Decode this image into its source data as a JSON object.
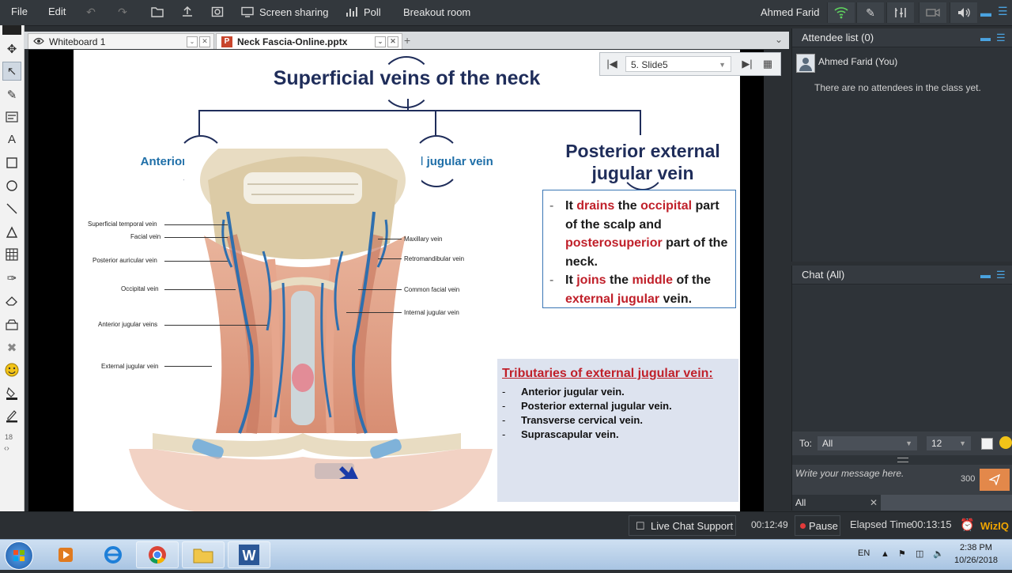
{
  "menu": {
    "file": "File",
    "edit": "Edit",
    "screen_sharing": "Screen sharing",
    "poll": "Poll",
    "breakout_room": "Breakout room",
    "user_name": "Ahmed Farid"
  },
  "tabs": [
    {
      "label": "Whiteboard 1"
    },
    {
      "label": "Neck Fascia-Online.pptx"
    }
  ],
  "slide_nav": {
    "current": "5. Slide5"
  },
  "slide": {
    "title": "Superficial veins of the neck",
    "branches": {
      "anterior": "Anterior jugular vein",
      "external": "External jugular vein",
      "posterior_line1": "Posterior external",
      "posterior_line2": "jugular vein"
    },
    "info": {
      "item1": {
        "p1": "It ",
        "drains": "drains",
        "p2": " the ",
        "occipital": "occipital",
        "p3": " part of the scalp and ",
        "posterosuperior": "posterosuperior",
        "p4": " part of the neck."
      },
      "item2": {
        "p1": "It ",
        "joins": "joins",
        "p2": " the ",
        "middle": "middle",
        "p3": " of the ",
        "ext": "external jugular",
        "p4": " vein."
      }
    },
    "tributaries": {
      "title": "Tributaries of external jugular vein:",
      "items": [
        "Anterior jugular vein.",
        "Posterior external jugular vein.",
        "Transverse cervical vein.",
        "Suprascapular vein."
      ]
    },
    "anatomy_labels_left": [
      "Superficial temporal vein",
      "Facial vein",
      "Posterior auricular vein",
      "Occipital vein",
      "Anterior jugular veins",
      "External jugular vein"
    ],
    "anatomy_labels_right": [
      "Maxillary vein",
      "Retromandibular vein",
      "Common facial vein",
      "Internal jugular vein"
    ]
  },
  "attendee_panel": {
    "title": "Attendee list (0)",
    "user": "Ahmed Farid (You)",
    "empty_text": "There are no attendees in the class yet."
  },
  "chat_panel": {
    "title": "Chat (All)",
    "to_label": "To:",
    "to_value": "All",
    "font_size": "12",
    "placeholder": "Write your message here.",
    "char_count": "300",
    "tab_all": "All"
  },
  "bottom": {
    "live_chat": "Live Chat Support",
    "session_time": "00:12:49",
    "pause": "Pause",
    "elapsed_label": "Elapsed Time",
    "elapsed_value": "00:13:15",
    "brand": "WizIQ"
  },
  "tool_size": "18",
  "taskbar": {
    "lang": "EN",
    "time": "2:38 PM",
    "date": "10/26/2018"
  },
  "colors": {
    "accent_blue": "#1f6fa8",
    "title_navy": "#1f2d5a",
    "highlight_red": "#c0202a",
    "record_red": "#e23a3a"
  }
}
